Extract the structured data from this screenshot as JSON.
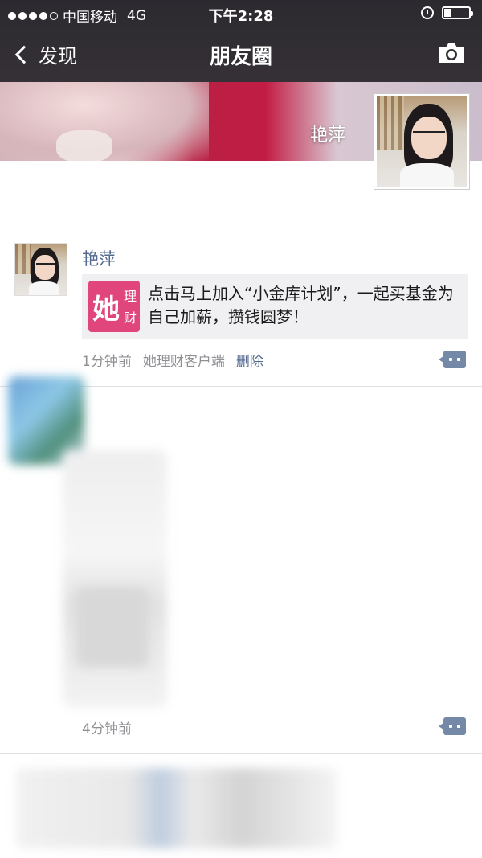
{
  "status_bar": {
    "carrier": "中国移动",
    "network": "4G",
    "time": "下午2:28"
  },
  "nav": {
    "back_label": "发现",
    "title": "朋友圈"
  },
  "cover": {
    "user_name": "艳萍"
  },
  "posts": [
    {
      "author": "艳萍",
      "share_logo_main": "她",
      "share_logo_sub1": "理",
      "share_logo_sub2": "财",
      "share_text": "点击马上加入“小金库计划”，一起买基金为自己加薪，攒钱圆梦！",
      "time": "1分钟前",
      "source": "她理财客户端",
      "delete_label": "删除"
    },
    {
      "time": "4分钟前"
    }
  ],
  "colors": {
    "nav_bg": "#2c2a2f",
    "link": "#556a91",
    "share_logo": "#e0457b"
  }
}
